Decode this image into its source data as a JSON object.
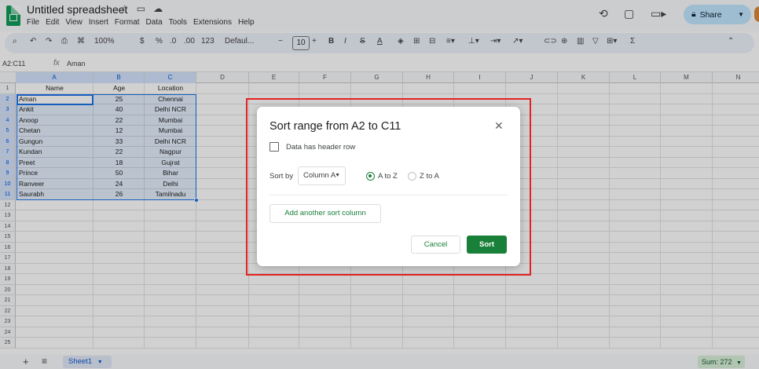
{
  "app": {
    "doc_title": "Untitled spreadsheet",
    "menu": [
      "File",
      "Edit",
      "View",
      "Insert",
      "Format",
      "Data",
      "Tools",
      "Extensions",
      "Help"
    ],
    "share_label": "Share"
  },
  "toolbar": {
    "zoom": "100%",
    "currency": "$",
    "percent": "%",
    "decimal_decrease": ".0",
    "decimal_increase": ".00",
    "number_format": "123",
    "font": "Defaul...",
    "font_size": "10",
    "bold": "B",
    "italic": "I",
    "strike": "S",
    "text_color": "A"
  },
  "formula_bar": {
    "name_box": "A2:C11",
    "fx": "fx",
    "value": "Aman"
  },
  "grid": {
    "columns": [
      "A",
      "B",
      "C",
      "D",
      "E",
      "F",
      "G",
      "H",
      "I",
      "J",
      "K",
      "L",
      "M",
      "N"
    ],
    "rows": [
      "1",
      "2",
      "3",
      "4",
      "5",
      "6",
      "7",
      "8",
      "9",
      "10",
      "11",
      "12",
      "13",
      "14",
      "15",
      "16",
      "17",
      "18",
      "19",
      "20",
      "21",
      "22",
      "23",
      "24",
      "25"
    ],
    "header": [
      "Name",
      "Age",
      "Location"
    ],
    "data": [
      [
        "Aman",
        "25",
        "Chennai"
      ],
      [
        "Ankit",
        "40",
        "Delhi NCR"
      ],
      [
        "Anoop",
        "22",
        "Mumbai"
      ],
      [
        "Chetan",
        "12",
        "Mumbai"
      ],
      [
        "Gungun",
        "33",
        "Delhi NCR"
      ],
      [
        "Kundan",
        "22",
        "Nagpur"
      ],
      [
        "Preet",
        "18",
        "Gujrat"
      ],
      [
        "Prince",
        "50",
        "Bihar"
      ],
      [
        "Ranveer",
        "24",
        "Delhi"
      ],
      [
        "Saurabh",
        "26",
        "Tamilnadu"
      ]
    ]
  },
  "bottom": {
    "sheet_name": "Sheet1",
    "sum": "Sum: 272"
  },
  "dialog": {
    "title": "Sort range from A2 to C11",
    "header_checkbox_label": "Data has header row",
    "sort_by_label": "Sort by",
    "column_value": "Column A",
    "option_az": "A to Z",
    "option_za": "Z to A",
    "add_column_label": "Add another sort column",
    "cancel_label": "Cancel",
    "sort_label": "Sort",
    "selected_order": "A to Z",
    "header_checked": false
  },
  "colors": {
    "accent": "#188038",
    "selection": "#1a73e8",
    "share_bg": "#c2e7ff",
    "highlight": "#e52222"
  }
}
